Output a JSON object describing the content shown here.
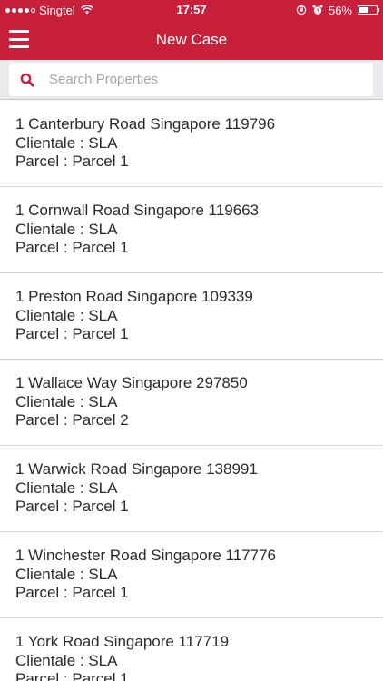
{
  "status_bar": {
    "carrier": "Singtel",
    "time": "17:57",
    "battery": "56%",
    "battery_level": 0.56
  },
  "header": {
    "title": "New Case"
  },
  "search": {
    "placeholder": "Search Properties"
  },
  "properties": [
    {
      "address": "1 Canterbury Road Singapore 119796",
      "clientale": "Clientale : SLA",
      "parcel": "Parcel : Parcel 1"
    },
    {
      "address": "1 Cornwall Road Singapore 119663",
      "clientale": "Clientale : SLA",
      "parcel": "Parcel : Parcel 1"
    },
    {
      "address": "1 Preston Road Singapore 109339",
      "clientale": "Clientale : SLA",
      "parcel": "Parcel : Parcel 1"
    },
    {
      "address": "1 Wallace Way Singapore 297850",
      "clientale": "Clientale : SLA",
      "parcel": "Parcel : Parcel 2"
    },
    {
      "address": "1 Warwick Road Singapore 138991",
      "clientale": "Clientale : SLA",
      "parcel": "Parcel : Parcel 1"
    },
    {
      "address": "1 Winchester Road Singapore 117776",
      "clientale": "Clientale : SLA",
      "parcel": "Parcel : Parcel 1"
    },
    {
      "address": "1 York Road Singapore 117719",
      "clientale": "Clientale : SLA",
      "parcel": "Parcel : Parcel 1"
    }
  ],
  "colors": {
    "brand": "#c8203b",
    "search_bg": "#e9e9ee",
    "divider": "#d6d6da"
  }
}
